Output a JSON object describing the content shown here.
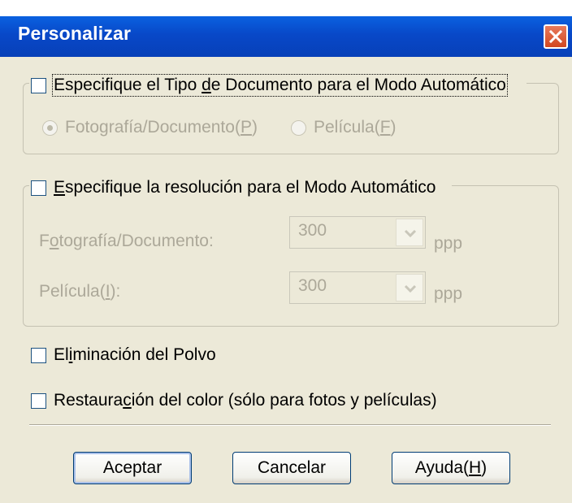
{
  "dialog": {
    "title": "Personalizar"
  },
  "group1": {
    "checkbox_label_pre": "Especifique el Tipo ",
    "checkbox_label_key": "d",
    "checkbox_label_post": "e Documento para el Modo Automático",
    "checked": false,
    "radio1_pre": "Fotografía/Documento(",
    "radio1_key": "P",
    "radio1_post": ")",
    "radio1_selected": true,
    "radio2_pre": "Película(",
    "radio2_key": "F",
    "radio2_post": ")",
    "radio2_selected": false
  },
  "group2": {
    "checkbox_label_key": "E",
    "checkbox_label_post": "specifique la resolución para el Modo Automático",
    "checked": false,
    "row1_label_pre": "F",
    "row1_label_key": "o",
    "row1_label_post": "tografía/Documento:",
    "row1_value": "300",
    "row2_label_pre": "Película(",
    "row2_label_key": "I",
    "row2_label_post": "):",
    "row2_value": "300",
    "unit": "ppp"
  },
  "options": {
    "dust_pre": "El",
    "dust_key": "i",
    "dust_post": "minación del Polvo",
    "dust_checked": false,
    "color_pre": "Restaura",
    "color_key": "c",
    "color_post": "ión del color (sólo para fotos y películas)",
    "color_checked": false
  },
  "buttons": {
    "ok": "Aceptar",
    "cancel": "Cancelar",
    "help_pre": "Ayuda(",
    "help_key": "H",
    "help_post": ")"
  },
  "colors": {
    "titlebar": "#0848c8",
    "background": "#ece9d8",
    "disabled_text": "#aca899"
  }
}
